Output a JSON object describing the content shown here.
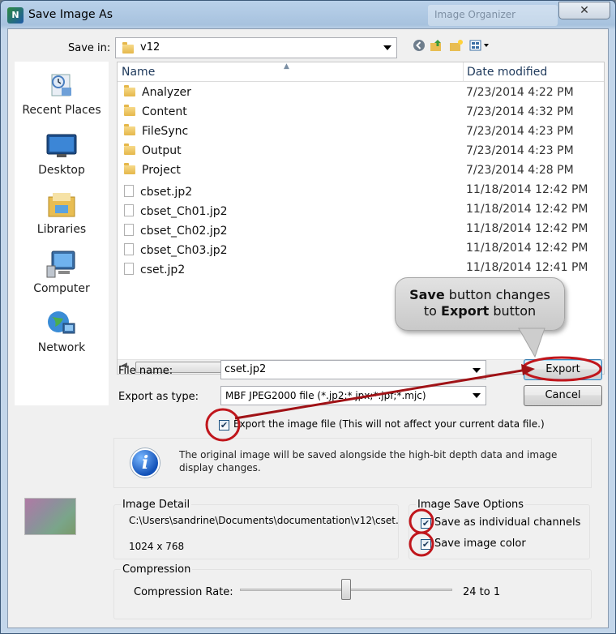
{
  "window": {
    "title": "Save Image As",
    "background_title": "Image Organizer",
    "close_glyph": "✕"
  },
  "save_in": {
    "label": "Save in:",
    "value": "v12"
  },
  "places": [
    {
      "label": "Recent Places",
      "icon": "recent-places-icon"
    },
    {
      "label": "Desktop",
      "icon": "desktop-icon"
    },
    {
      "label": "Libraries",
      "icon": "libraries-icon"
    },
    {
      "label": "Computer",
      "icon": "computer-icon"
    },
    {
      "label": "Network",
      "icon": "network-icon"
    }
  ],
  "file_list": {
    "columns": [
      "Name",
      "Date modified"
    ],
    "rows": [
      {
        "name": "Analyzer",
        "date": "7/23/2014 4:22 PM",
        "type": "folder"
      },
      {
        "name": "Content",
        "date": "7/23/2014 4:32 PM",
        "type": "folder"
      },
      {
        "name": "FileSync",
        "date": "7/23/2014 4:23 PM",
        "type": "folder"
      },
      {
        "name": "Output",
        "date": "7/23/2014 4:23 PM",
        "type": "folder"
      },
      {
        "name": "Project",
        "date": "7/23/2014 4:28 PM",
        "type": "folder"
      },
      {
        "name": "cbset.jp2",
        "date": "11/18/2014 12:42 PM",
        "type": "file"
      },
      {
        "name": "cbset_Ch01.jp2",
        "date": "11/18/2014 12:42 PM",
        "type": "file"
      },
      {
        "name": "cbset_Ch02.jp2",
        "date": "11/18/2014 12:42 PM",
        "type": "file"
      },
      {
        "name": "cbset_Ch03.jp2",
        "date": "11/18/2014 12:42 PM",
        "type": "file"
      },
      {
        "name": "cset.jp2",
        "date": "11/18/2014 12:41 PM",
        "type": "file"
      }
    ]
  },
  "form": {
    "file_name_label": "File name:",
    "file_name_value": "cset.jp2",
    "type_label": "Export as type:",
    "type_value": "MBF JPEG2000 file (*.jp2;*.jpx;*.jpf;*.mjc)",
    "export_button": "Export",
    "cancel_button": "Cancel",
    "export_checkbox_label": "Export the image file (This will not affect your current data file.)",
    "export_checked": true
  },
  "info": {
    "text": "The original image will be saved alongside the high-bit depth data and image display changes."
  },
  "image_detail": {
    "title": "Image Detail",
    "path": "C:\\Users\\sandrine\\Documents\\documentation\\v12\\cset.",
    "size": "1024 x 768"
  },
  "save_options": {
    "title": "Image Save Options",
    "individual_channels": "Save as individual channels",
    "individual_checked": true,
    "image_color": "Save image color",
    "color_checked": true
  },
  "compression": {
    "title": "Compression",
    "rate_label": "Compression Rate:",
    "rate_value": "24 to 1",
    "slider_fraction": 0.5
  },
  "annotation": {
    "callout_bold1": "Save",
    "callout_text1": " button changes",
    "callout_text2": "to ",
    "callout_bold2": "Export",
    "callout_text3": " button",
    "color": "#c0161c"
  }
}
